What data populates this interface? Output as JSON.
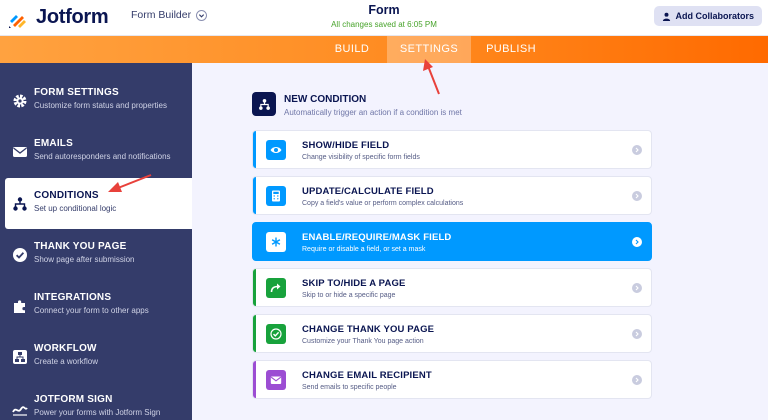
{
  "header": {
    "logo_text": "Jotform",
    "builder_label": "Form Builder",
    "form_title": "Form",
    "save_status": "All changes saved at 6:05 PM",
    "collaborators_label": "Add Collaborators"
  },
  "nav": {
    "tabs": [
      {
        "label": "BUILD"
      },
      {
        "label": "SETTINGS"
      },
      {
        "label": "PUBLISH"
      }
    ],
    "active_tab": "SETTINGS"
  },
  "sidebar": {
    "items": [
      {
        "title": "FORM SETTINGS",
        "subtitle": "Customize form status and properties",
        "icon": "gear-icon"
      },
      {
        "title": "EMAILS",
        "subtitle": "Send autoresponders and notifications",
        "icon": "envelope-icon"
      },
      {
        "title": "CONDITIONS",
        "subtitle": "Set up conditional logic",
        "icon": "hierarchy-icon"
      },
      {
        "title": "THANK YOU PAGE",
        "subtitle": "Show page after submission",
        "icon": "check-circle-icon"
      },
      {
        "title": "INTEGRATIONS",
        "subtitle": "Connect your form to other apps",
        "icon": "puzzle-icon"
      },
      {
        "title": "WORKFLOW",
        "subtitle": "Create a workflow",
        "icon": "workflow-icon"
      },
      {
        "title": "JOTFORM SIGN",
        "subtitle": "Power your forms with Jotform Sign",
        "icon": "sign-icon"
      }
    ],
    "active_item": "CONDITIONS"
  },
  "main": {
    "new_condition_title": "NEW CONDITION",
    "new_condition_subtitle": "Automatically trigger an action if a condition is met",
    "cards": [
      {
        "title": "SHOW/HIDE FIELD",
        "subtitle": "Change visibility of specific form fields",
        "color": "#0099ff",
        "icon": "eye-icon"
      },
      {
        "title": "UPDATE/CALCULATE FIELD",
        "subtitle": "Copy a field's value or perform complex calculations",
        "color": "#0099ff",
        "icon": "calculator-icon"
      },
      {
        "title": "ENABLE/REQUIRE/MASK FIELD",
        "subtitle": "Require or disable a field, or set a mask",
        "color": "#0099ff",
        "icon": "asterisk-icon"
      },
      {
        "title": "SKIP TO/HIDE A PAGE",
        "subtitle": "Skip to or hide a specific page",
        "color": "#18a23c",
        "icon": "skip-arrow-icon"
      },
      {
        "title": "CHANGE THANK YOU PAGE",
        "subtitle": "Customize your Thank You page action",
        "color": "#18a23c",
        "icon": "check-icon"
      },
      {
        "title": "CHANGE EMAIL RECIPIENT",
        "subtitle": "Send emails to specific people",
        "color": "#9c4dd3",
        "icon": "envelope-icon"
      }
    ],
    "highlighted_card": "ENABLE/REQUIRE/MASK FIELD"
  },
  "colors": {
    "brand_navy": "#0a1551",
    "sidebar_bg": "#343c6a",
    "orange": "#ff8a1f",
    "blue": "#0099ff",
    "green": "#18a23c",
    "purple": "#9c4dd3",
    "annotation_red": "#e8413b"
  }
}
